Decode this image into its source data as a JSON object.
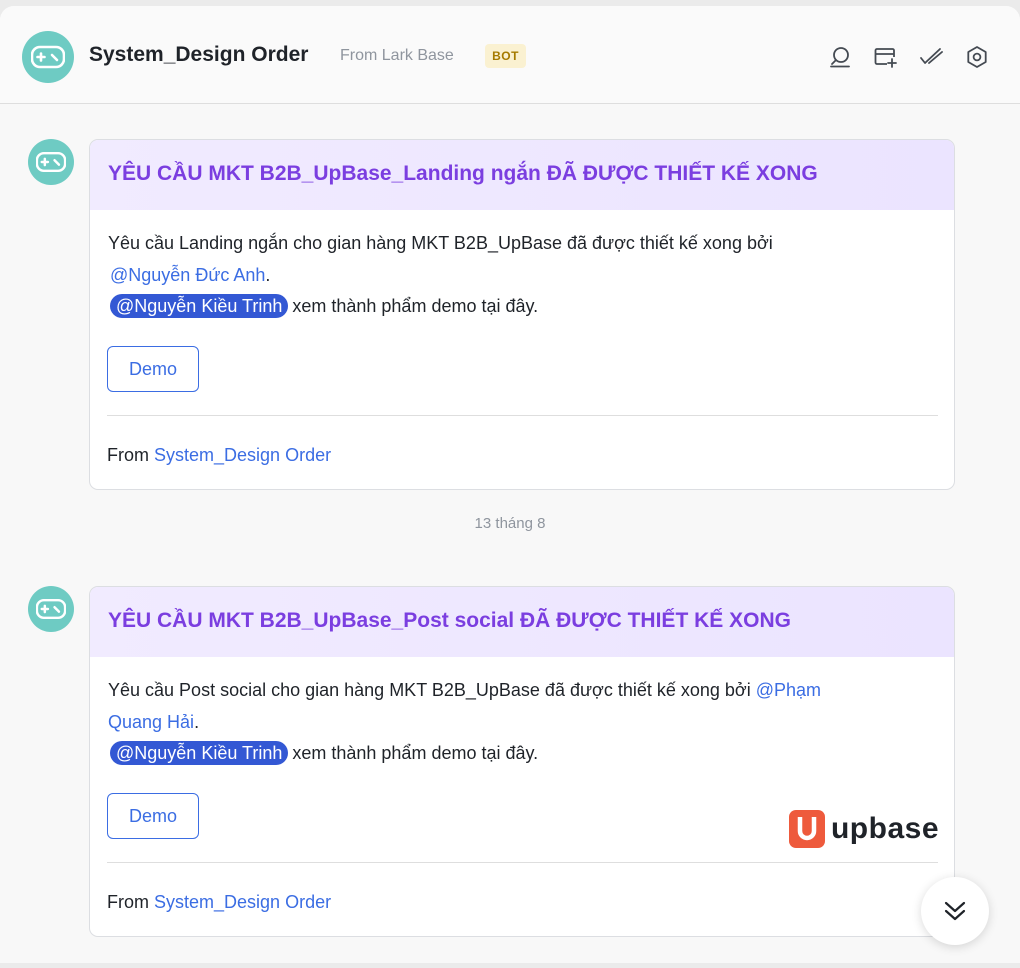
{
  "header": {
    "title": "System_Design Order",
    "subtitle": "From Lark Base",
    "badge": "BOT",
    "avatar_icon": "gamepad-icon",
    "actions": [
      {
        "icon": "search-icon"
      },
      {
        "icon": "add-tab-icon"
      },
      {
        "icon": "mark-done-icon"
      },
      {
        "icon": "settings-icon"
      }
    ]
  },
  "messages": [
    {
      "title": "YÊU CẦU MKT B2B_UpBase_Landing ngắn ĐÃ ĐƯỢC THIẾT KẾ XONG",
      "line1_text": "Yêu cầu Landing ngắn cho gian hàng MKT B2B_UpBase đã được thiết kế xong bởi",
      "line2_mention": "@Nguyễn Đức Anh",
      "line2_period": ".",
      "line3_mention": "@Nguyễn Kiều Trinh",
      "line3_text": "xem thành phẩm demo tại đây.",
      "button": "Demo",
      "footer_prefix": "From",
      "footer_link": "System_Design Order"
    },
    {
      "title": "YÊU CẦU MKT B2B_UpBase_Post social ĐÃ ĐƯỢC THIẾT KẾ XONG",
      "line1_text": "Yêu cầu Post social cho gian hàng MKT B2B_UpBase đã được thiết kế xong bởi",
      "line1_mention": "@Phạm",
      "line2_mention": "Quang Hải",
      "line2_period": ".",
      "line3_mention": "@Nguyễn Kiều Trinh",
      "line3_text": "xem thành phẩm demo tại đây.",
      "button": "Demo",
      "logo_text": "upbase",
      "footer_prefix": "From",
      "footer_link": "System_Design Order"
    }
  ],
  "date_separator": "13 tháng 8",
  "colors": {
    "accent": "#3b6de3",
    "title_purple": "#7b3ee0",
    "mention_pill": "#3358d4",
    "avatar_teal": "#6ecbc3",
    "upbase_orange": "#ee5a3c"
  }
}
